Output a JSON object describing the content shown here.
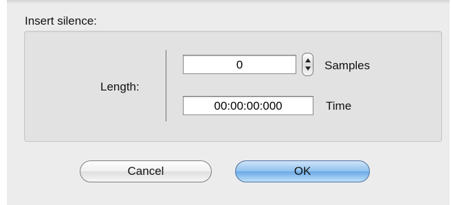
{
  "group": {
    "title": "Insert silence:"
  },
  "length": {
    "label": "Length:",
    "samples_value": "0",
    "samples_unit": "Samples",
    "time_value": "00:00:00:000",
    "time_unit": "Time"
  },
  "buttons": {
    "cancel": "Cancel",
    "ok": "OK"
  },
  "colors": {
    "dialog_bg": "#ececec",
    "group_bg": "#e2e2e2",
    "ok_accent": "#6aa9e6"
  }
}
